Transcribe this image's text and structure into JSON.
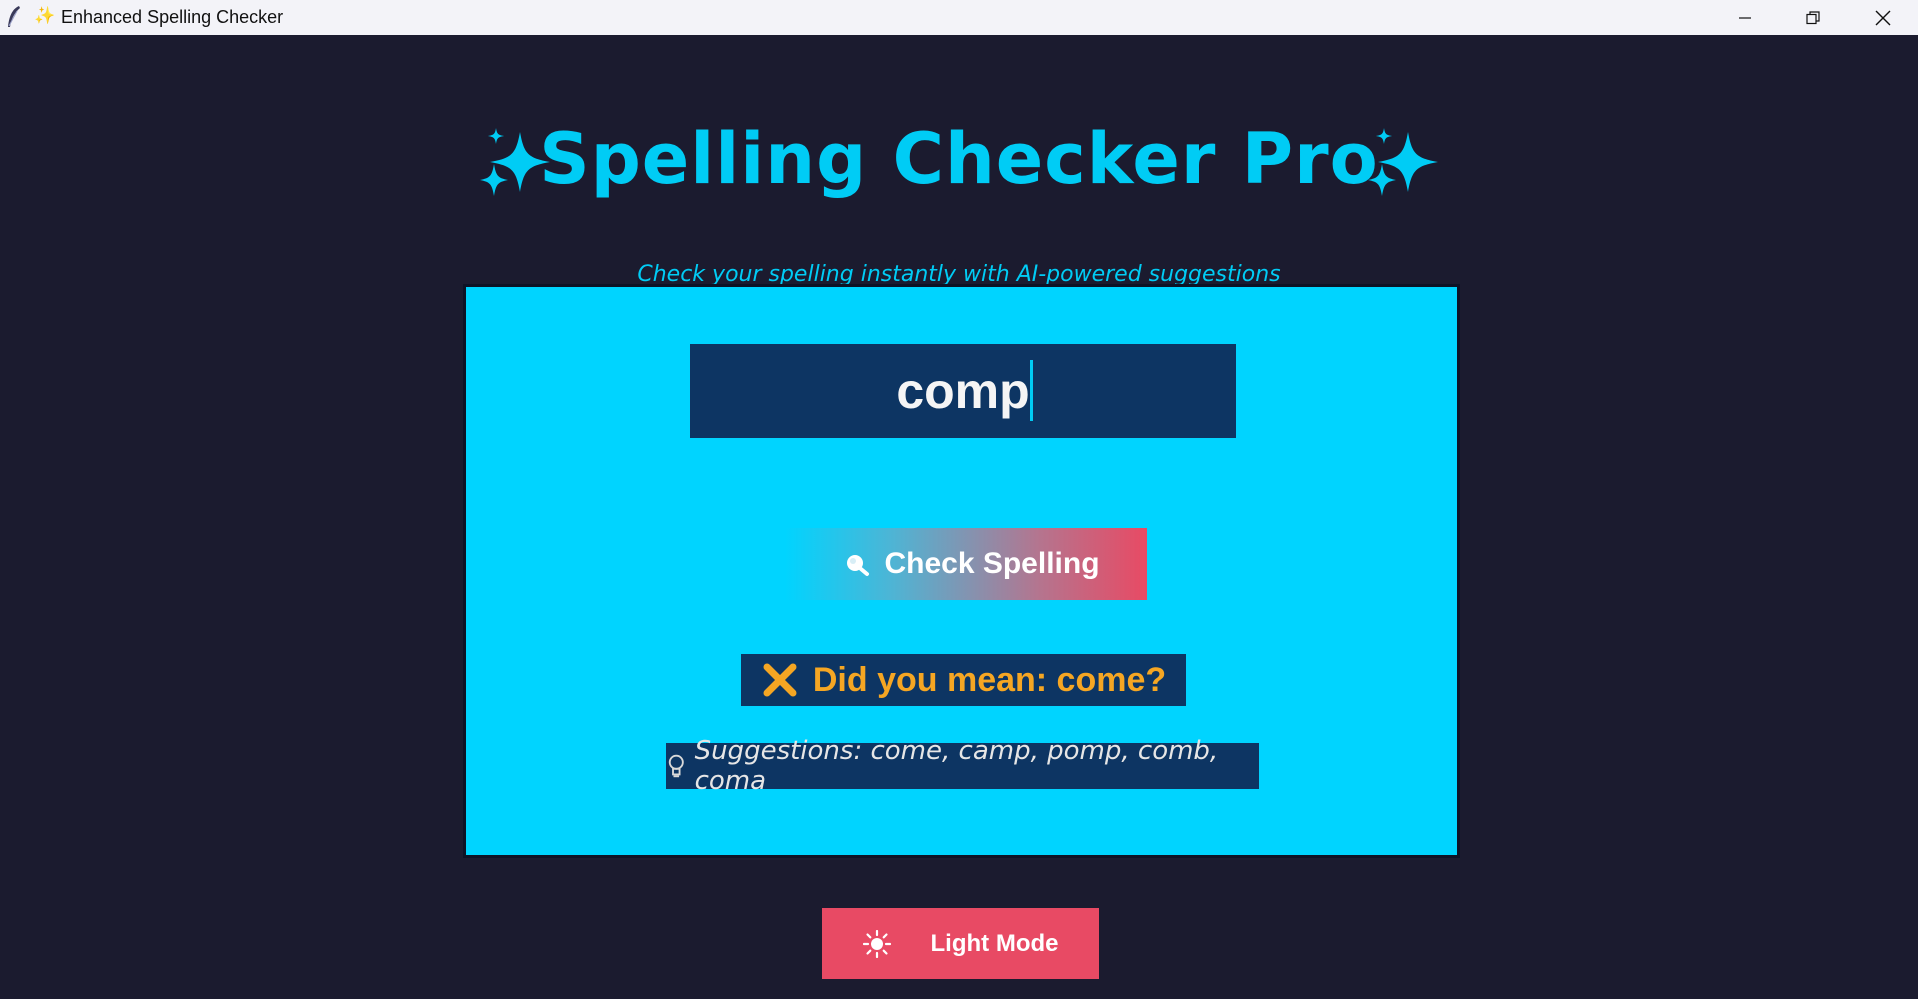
{
  "window": {
    "title": "Enhanced Spelling Checker",
    "title_icon": "✨"
  },
  "header": {
    "title": "Spelling Checker Pro",
    "sparkle_icon": "sparkles-icon",
    "subtitle": "Check your spelling instantly with AI-powered suggestions"
  },
  "checker": {
    "input_value": "comp",
    "check_button_label": "Check Spelling",
    "check_button_icon": "magnifier-icon",
    "result_text": "Did you mean: come?",
    "result_icon": "cross-mark-icon",
    "suggestions_text": "Suggestions: come, camp, pomp, comb, coma",
    "suggestions_icon": "lightbulb-icon"
  },
  "theme": {
    "toggle_label": "Light Mode",
    "toggle_icon": "sun-icon"
  },
  "colors": {
    "background": "#1b1b2f",
    "accent": "#00ccf5",
    "panel": "#00d4ff",
    "input_bg": "#0d3563",
    "button_pink": "#e84a64",
    "result_orange": "#f5a623"
  }
}
